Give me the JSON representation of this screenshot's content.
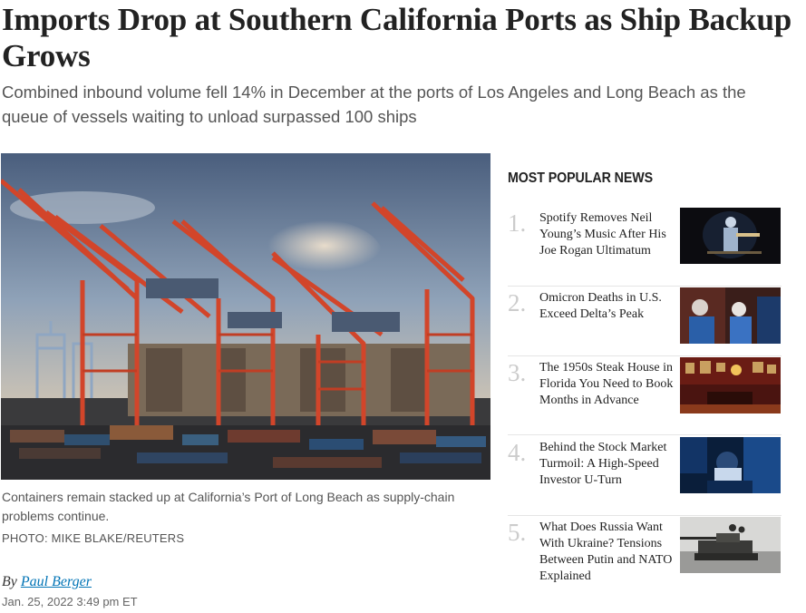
{
  "article": {
    "headline": "Imports Drop at Southern California Ports as Ship Backup Grows",
    "dek": "Combined inbound volume fell 14% in December at the ports of Los Angeles and Long Beach as the queue of vessels waiting to unload surpassed 100 ships",
    "caption": "Containers remain stacked up at California’s Port of Long Beach as supply-chain problems continue.",
    "photo_credit": "PHOTO: MIKE BLAKE/REUTERS",
    "byline_prefix": "By",
    "author": "Paul Berger",
    "date": "Jan. 25, 2022 3:49 pm ET"
  },
  "popular": {
    "title": "MOST POPULAR NEWS",
    "items": [
      {
        "num": "1.",
        "title": "Spotify Removes Neil Young’s Music After His Joe Rogan Ultimatum",
        "thumb": "concert-photo"
      },
      {
        "num": "2.",
        "title": "Omicron Deaths in U.S. Exceed Delta’s Peak",
        "thumb": "medical-photo"
      },
      {
        "num": "3.",
        "title": "The 1950s Steak House in Florida You Need to Book Months in Advance",
        "thumb": "restaurant-photo"
      },
      {
        "num": "4.",
        "title": "Behind the Stock Market Turmoil: A High-Speed Investor U-Turn",
        "thumb": "trader-photo"
      },
      {
        "num": "5.",
        "title": "What Does Russia Want With Ukraine? Tensions Between Putin and NATO Explained",
        "thumb": "tank-photo"
      }
    ]
  },
  "colors": {
    "crane": "#d2452a",
    "link": "#0274b6",
    "rank": "#cccccc"
  }
}
